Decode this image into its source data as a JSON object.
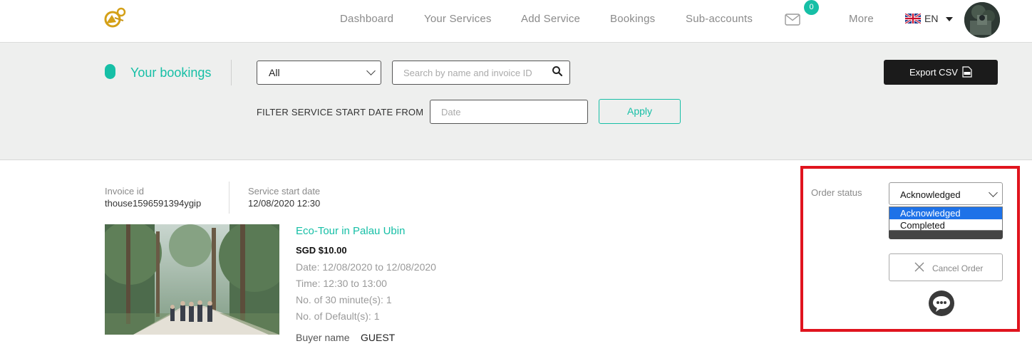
{
  "nav": {
    "links": [
      "Dashboard",
      "Your Services",
      "Add Service",
      "Bookings",
      "Sub-accounts",
      "More"
    ],
    "mail_count": "0",
    "language": "EN",
    "colors": {
      "accent": "#16bfa6"
    }
  },
  "filters": {
    "title": "Your bookings",
    "status_selected": "All",
    "search_placeholder": "Search by name and invoice ID",
    "export_label": "Export CSV",
    "date_filter_label": "FILTER SERVICE START DATE FROM",
    "date_placeholder": "Date",
    "apply_label": "Apply"
  },
  "booking": {
    "invoice_label": "Invoice id",
    "invoice_id": "thouse1596591394ygip",
    "start_label": "Service start date",
    "start_value": "12/08/2020 12:30",
    "service_title": "Eco-Tour in Palau Ubin",
    "price": "SGD $10.00",
    "details": [
      "Date: 12/08/2020 to 12/08/2020",
      "Time: 12:30 to 13:00",
      "No. of 30 minute(s): 1",
      "No. of Default(s): 1"
    ],
    "buyer_label": "Buyer name",
    "buyer_value": "GUEST"
  },
  "order": {
    "status_label": "Order status",
    "status_selected": "Acknowledged",
    "options": [
      "Acknowledged",
      "Completed"
    ],
    "cancel_label": "Cancel Order"
  },
  "icons": {
    "mail": "mail-icon",
    "search": "search-icon",
    "csv": "csv-file-icon",
    "cancel": "close-icon",
    "chat": "chat-bubble-icon",
    "flag": "uk-flag-icon"
  }
}
